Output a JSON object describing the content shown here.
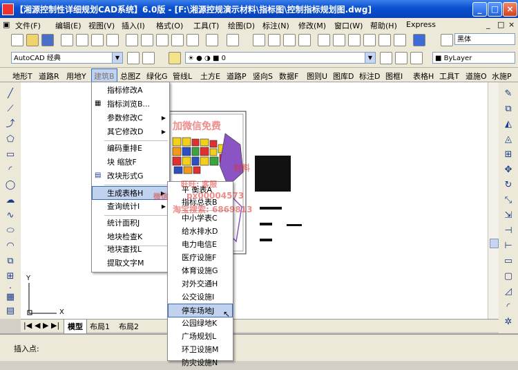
{
  "window": {
    "title": "【湘源控制性详细规划CAD系统】6.0版 - [F:\\湘源控规演示材料\\指标图\\控制指标规划图.dwg]"
  },
  "menubar": {
    "items": [
      "文件(F)",
      "编辑(E)",
      "视图(V)",
      "插入(I)",
      "格式(O)",
      "工具(T)",
      "绘图(D)",
      "标注(N)",
      "修改(M)",
      "窗口(W)",
      "帮助(H)",
      "Express"
    ],
    "right_controls": [
      "_",
      "□",
      "×"
    ]
  },
  "toolbar2": {
    "font_select": "黑体",
    "workspace_select": "AutoCAD 经典",
    "layer_select": "0",
    "color_select": "ByLayer"
  },
  "custom_menu": {
    "items": [
      "地形T",
      "道路R",
      "用地Y",
      "建筑B",
      "总图Z",
      "绿化G",
      "管线L",
      "土方E",
      "道路P",
      "竖向S",
      "数据F",
      "图则U",
      "图库D",
      "标注D",
      "图框I",
      "表格H",
      "工具T",
      "道施O",
      "水施P"
    ]
  },
  "dropdown1": {
    "items": [
      "指标修改A",
      "指标浏览B...",
      "参数修改C",
      "其它修改D",
      "编码重排E",
      "块  缩放F",
      "改块形式G",
      "生成表格H",
      "查询统计I",
      "统计面积J",
      "地块检查K",
      "地块查找L",
      "提取文字M"
    ]
  },
  "dropdown2": {
    "items": [
      "平  衡表A",
      "指标总表B",
      "中小学表C",
      "给水排水D",
      "电力电信E",
      "医疗设施F",
      "体育设施G",
      "对外交通H",
      "公交设施I",
      "停车场地J",
      "公园绿地K",
      "广场规划L",
      "环卫设施M",
      "防灾设施N"
    ]
  },
  "layout_tabs": {
    "nav": [
      "|◀",
      "◀",
      "▶",
      "▶|"
    ],
    "tabs": [
      "模型",
      "布局1",
      "布局2"
    ]
  },
  "ucs": {
    "y_label": "Y",
    "x_label": "X"
  },
  "command_line": {
    "prompt": "插入点:"
  },
  "watermark": {
    "line1": "加微信免费",
    "line2": "材料",
    "line3": "旺旺: 客服",
    "line4": "px00004573",
    "line5": "淘宝搜索: 6869813",
    "line6": "微信"
  },
  "colors": {
    "title_bar": "#0a4fd0",
    "highlight": "#c1d2ee",
    "watermark": "#e0302c"
  }
}
